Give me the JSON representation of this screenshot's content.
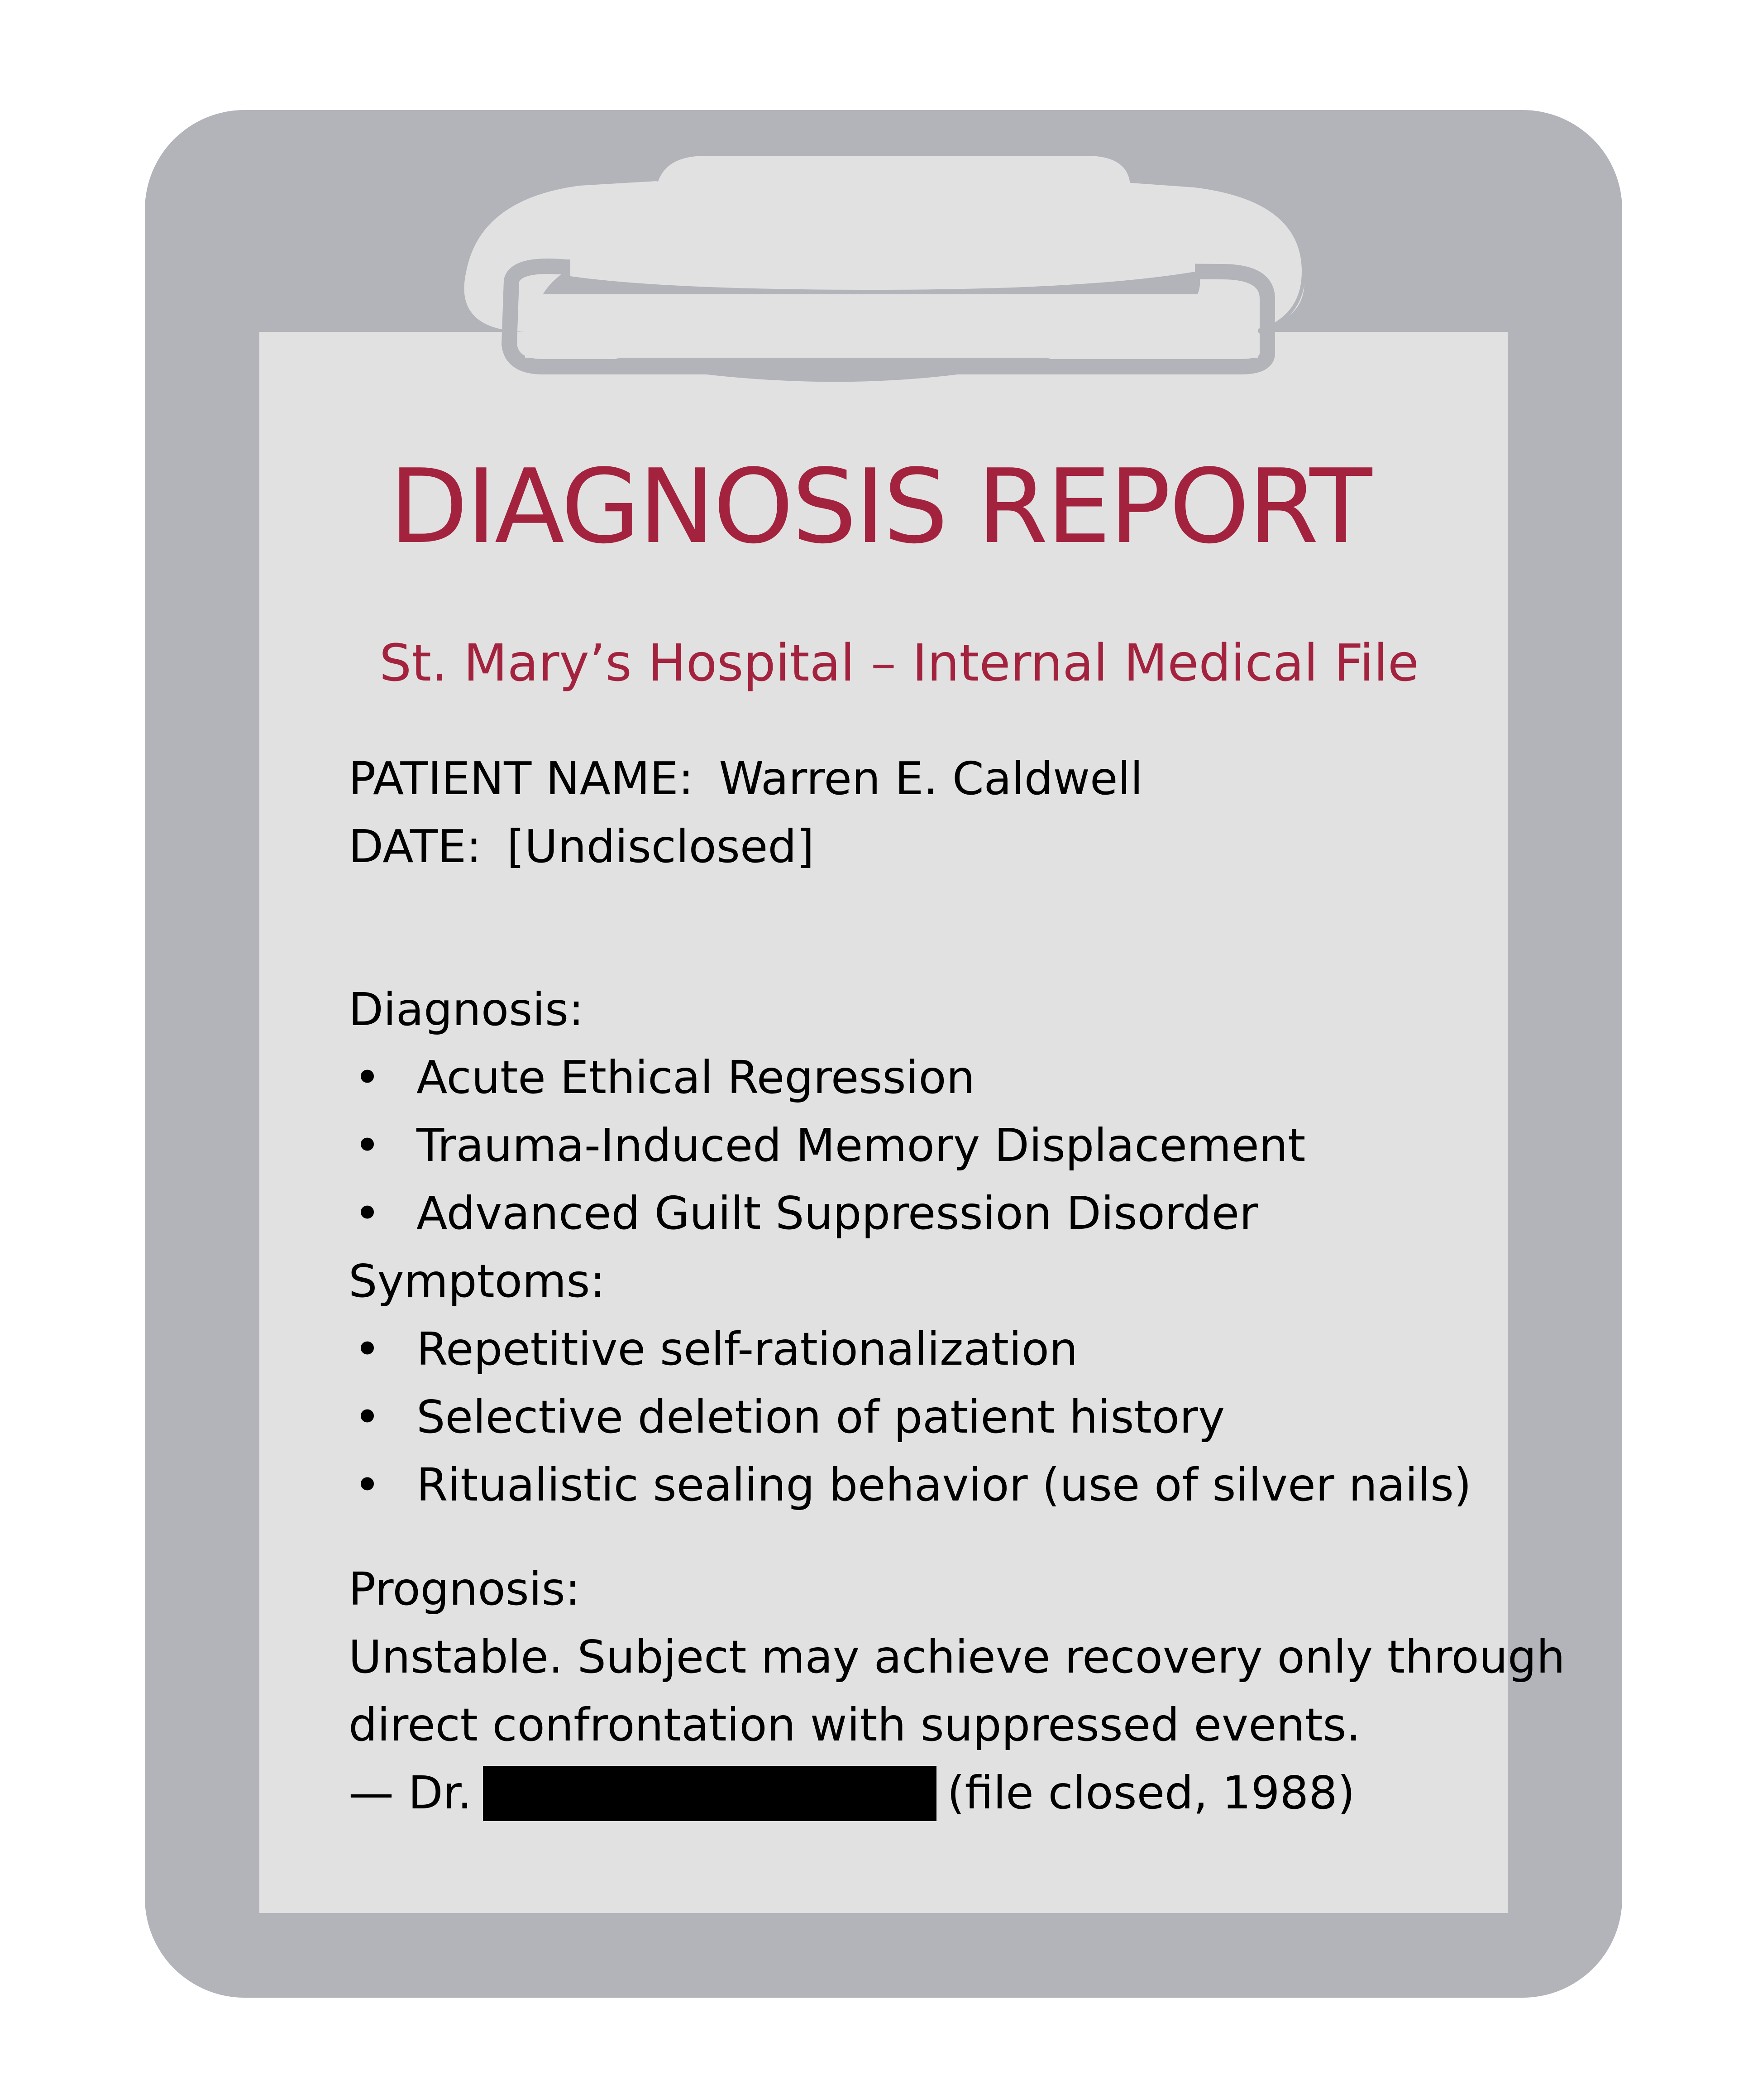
{
  "report": {
    "title": "DIAGNOSIS REPORT",
    "subtitle": "St. Mary’s Hospital – Internal Medical File",
    "patient_label": "PATIENT NAME:",
    "patient_value": "Warren E. Caldwell",
    "date_label": "DATE:",
    "date_value": "[Undisclosed]",
    "diagnosis_heading": "Diagnosis:",
    "diagnosis_items": [
      "Acute Ethical Regression",
      "Trauma-Induced Memory Displacement",
      "Advanced Guilt Suppression Disorder"
    ],
    "symptoms_heading": "Symptoms:",
    "symptoms_items": [
      "Repetitive self-rationalization",
      "Selective deletion of patient history",
      "Ritualistic sealing behavior (use of silver nails)"
    ],
    "prognosis_heading": "Prognosis:",
    "prognosis_line1": "Unstable. Subject may achieve recovery only through",
    "prognosis_line2": "direct confrontation with suppressed events.",
    "signature_prefix": "— Dr.",
    "signature_suffix": "(file closed, 1988)",
    "bullet_glyph": "•"
  },
  "colors": {
    "accent": "#a3233f",
    "board": "#b2b4ba",
    "paper": "#e1e1e1",
    "text": "#000000"
  }
}
